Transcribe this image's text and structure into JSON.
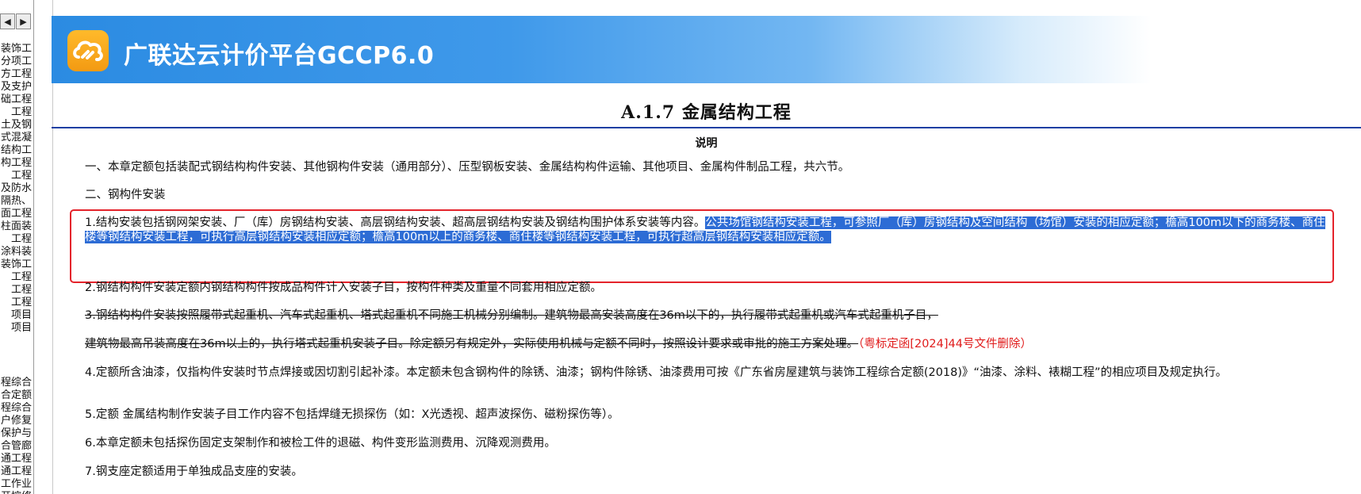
{
  "nav": {
    "prev": "◀",
    "next": "▶"
  },
  "tree": {
    "items_top": [
      "装饰工",
      "分项工",
      "方工程",
      "及支护",
      "础工程",
      "工程",
      "土及钢",
      "式混凝",
      "结构工",
      "构工程",
      "工程",
      "及防水",
      "、隔热",
      "面工程",
      "柱面装",
      "工程",
      "涂料装",
      "装饰工",
      "工程",
      "工程",
      "工程",
      "项目",
      "项目"
    ],
    "items_bottom": [
      "程综合",
      "合定额",
      "程综合",
      "户修复",
      "保护与",
      "合管廊",
      "通工程",
      "通工程",
      "工作业",
      "开挖修"
    ]
  },
  "banner": {
    "title": "广联达云计价平台GCCP6.0",
    "logo_icon": "cloud-logo-icon",
    "color": "#2b8be2"
  },
  "doc": {
    "title": "A.1.7 金属结构工程",
    "subtitle": "说明",
    "p1": "一、本章定额包括装配式钢结构构件安装、其他钢构件安装（通用部分）、压型钢板安装、金属结构构件运输、其他项目、金属构件制品工程，共六节。",
    "p2": "二、钢构件安装",
    "p3_normal": "1.结构安装包括钢网架安装、厂（库）房钢结构安装、高层钢结构安装、超高层钢结构安装及钢结构围护体系安装等内容。",
    "p3_highlight": "公共场馆钢结构安装工程，可参照厂（库）房钢结构及空间结构（场馆）安装的相应定额；檐高100m以下的商务楼、商住楼等钢结构安装工程，可执行高层钢结构安装相应定额；檐高100m以上的商务楼、商住楼等钢结构安装工程，可执行超高层钢结构安装相应定额。",
    "p4": "2.钢结构构件安装定额内钢结构构件按成品构件计入安装子目，按构件种类及重量不同套用相应定额。",
    "p5": "3.钢结构构件安装按照履带式起重机、汽车式起重机、塔式起重机不同施工机械分别编制。建筑物最高安装高度在36m以下的，执行履带式起重机或汽车式起重机子目，",
    "p6_strike": "建筑物最高吊装高度在36m以上的，执行塔式起重机安装子目。除定额另有规定外，实际使用机械与定额不同时，按照设计要求或审批的施工方案处理。",
    "p6_red": "（粤标定函[2024]44号文件删除）",
    "p7": "4.定额所含油漆，仅指构件安装时节点焊接或因切割引起补漆。本定额未包含钢构件的除锈、油漆；钢构件除锈、油漆费用可按《广东省房屋建筑与装饰工程综合定额(2018)》“油漆、涂料、裱糊工程”的相应项目及规定执行。",
    "p8": "5.定额 金属结构制作安装子目工作内容不包括焊缝无损探伤（如：X光透视、超声波探伤、磁粉探伤等）。",
    "p9": "6.本章定额未包括探伤固定支架制作和被检工件的退磁、构件变形监测费用、沉降观测费用。",
    "p10": "7.钢支座定额适用于单独成品支座的安装。"
  },
  "colors": {
    "highlight": "#2d6cd5",
    "annotation_box": "#e4232b",
    "deleted_note": "#e01b1b",
    "rule": "#1e3fa3"
  }
}
